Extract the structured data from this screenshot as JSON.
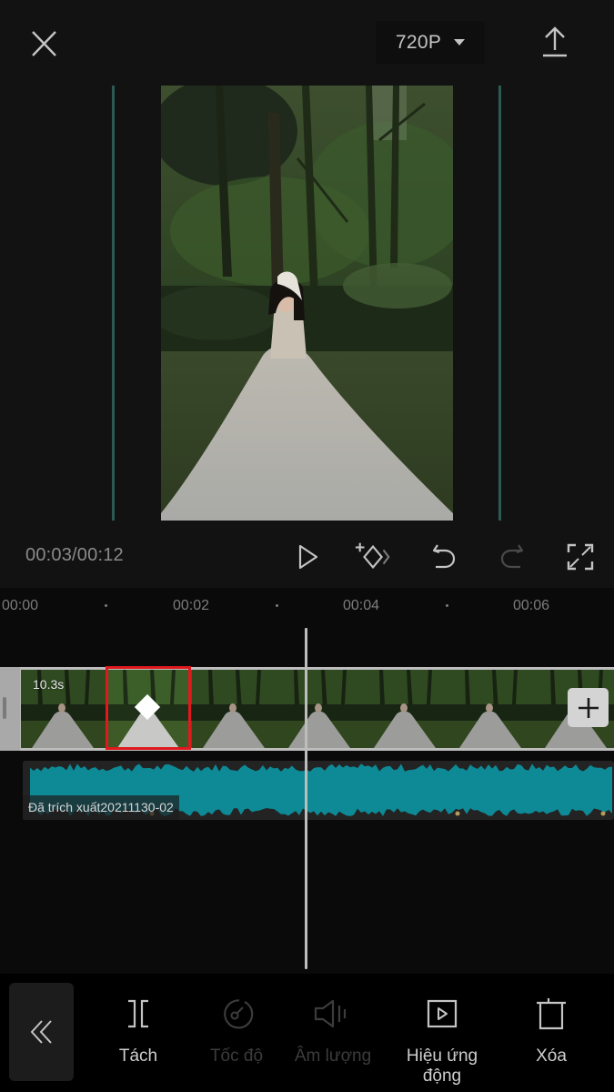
{
  "header": {
    "close_icon": "close-icon",
    "resolution": "720P",
    "export_icon": "export-upload-icon"
  },
  "player": {
    "current_time": "00:03",
    "total_time": "00:12",
    "timecode": "00:03/00:12",
    "controls": [
      {
        "name": "play",
        "icon": "play-icon",
        "enabled": true
      },
      {
        "name": "add-keyframe",
        "icon": "add-keyframe-icon",
        "enabled": true
      },
      {
        "name": "undo",
        "icon": "undo-icon",
        "enabled": true
      },
      {
        "name": "redo",
        "icon": "redo-icon",
        "enabled": false
      },
      {
        "name": "fullscreen",
        "icon": "fullscreen-icon",
        "enabled": true
      }
    ]
  },
  "timeline": {
    "ruler": [
      "00:00",
      "00:02",
      "00:04",
      "00:06"
    ],
    "video_clip": {
      "duration": "10.3s",
      "selected_frame_index": 1,
      "frame_count": 7
    },
    "audio_clip": {
      "label": "Đã trích xuất20211130-02",
      "color": "#0d8a96"
    },
    "accent_colors": {
      "selection": "#e0191e",
      "guide": "#2e5a55"
    }
  },
  "toolbar": {
    "back_icon": "double-chevron-left-icon",
    "items": [
      {
        "label": "Tách",
        "icon": "split-icon",
        "enabled": true
      },
      {
        "label": "Tốc độ",
        "icon": "speed-icon",
        "enabled": false
      },
      {
        "label": "Âm lượng",
        "icon": "volume-icon",
        "enabled": false
      },
      {
        "label": "Hiệu ứng động",
        "icon": "animation-icon",
        "enabled": true
      },
      {
        "label": "Xóa",
        "icon": "delete-icon",
        "enabled": true
      }
    ]
  }
}
